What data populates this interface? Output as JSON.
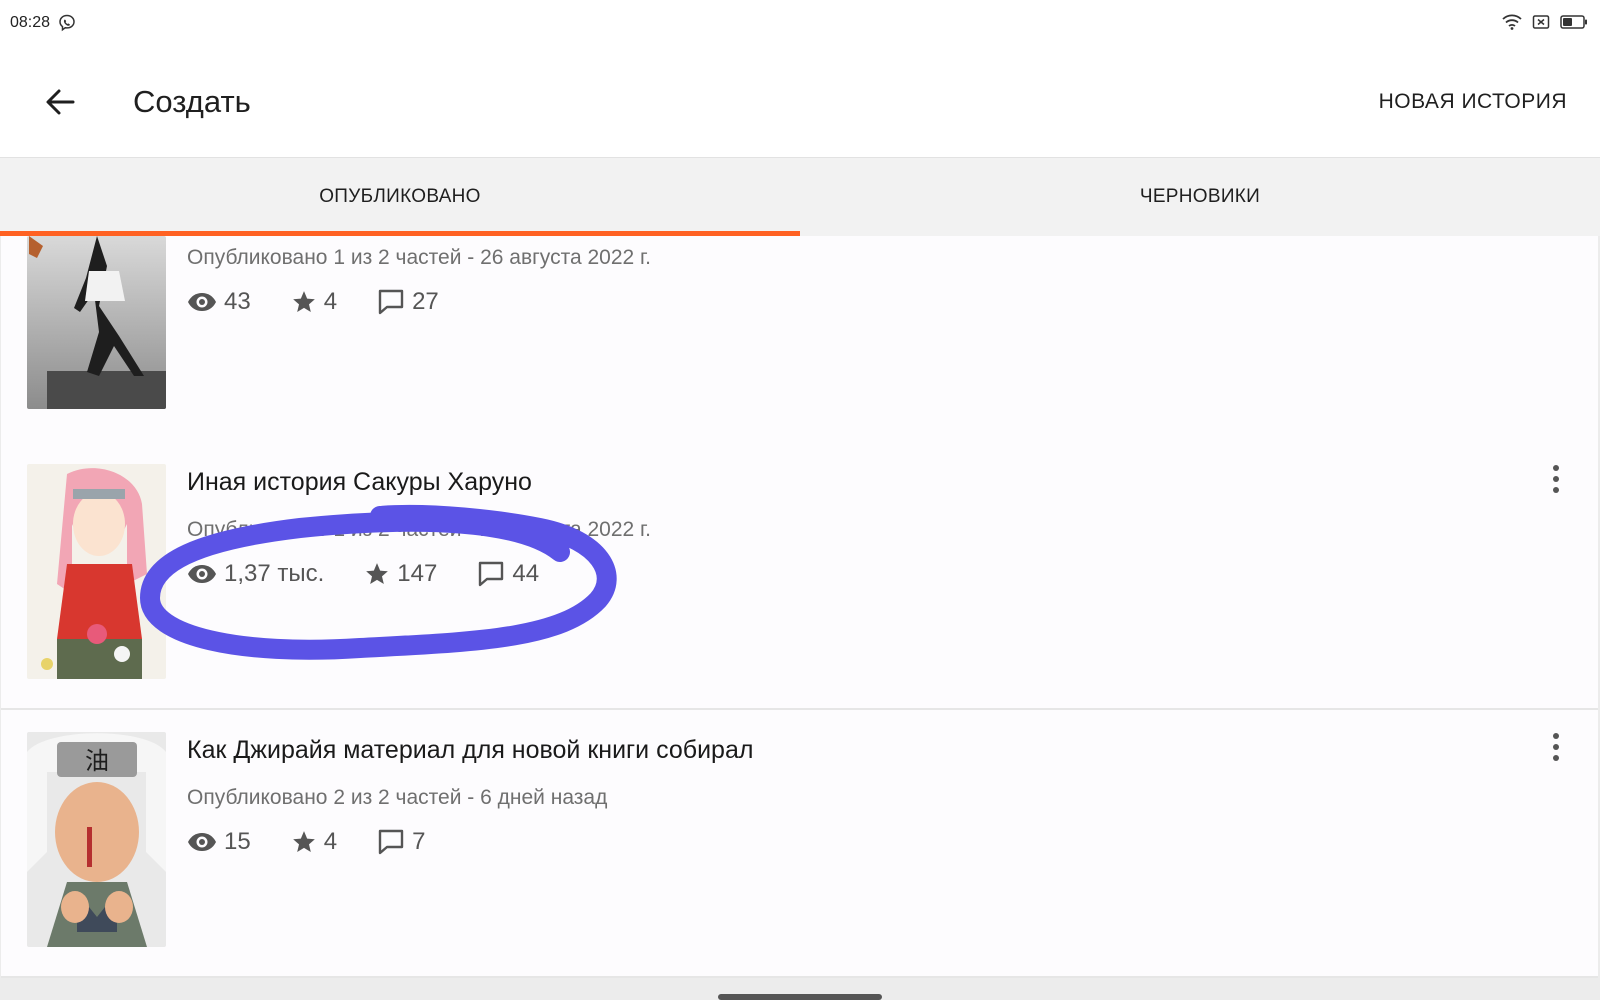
{
  "status_bar": {
    "time": "08:28"
  },
  "app_bar": {
    "title": "Создать",
    "new_story_label": "НОВАЯ ИСТОРИЯ"
  },
  "tabs": [
    {
      "label": "ОПУБЛИКОВАНО",
      "active": true
    },
    {
      "label": "ЧЕРНОВИКИ",
      "active": false
    }
  ],
  "stories": [
    {
      "title": "",
      "meta": "Опубликовано 1 из 2 частей - 26 августа 2022 г.",
      "views": "43",
      "stars": "4",
      "comments": "27"
    },
    {
      "title": "Иная история Сакуры Харуно",
      "meta": "Опубликовано 1 из 2 частей - 29 августа 2022 г.",
      "views": "1,37 тыс.",
      "stars": "147",
      "comments": "44"
    },
    {
      "title": "Как Джирайя материал для новой книги собирал",
      "meta": "Опубликовано 2 из 2 частей - 6 дней назад",
      "views": "15",
      "stars": "4",
      "comments": "7"
    }
  ],
  "colors": {
    "accent": "#ff6122",
    "annotation": "#5b53e6"
  }
}
